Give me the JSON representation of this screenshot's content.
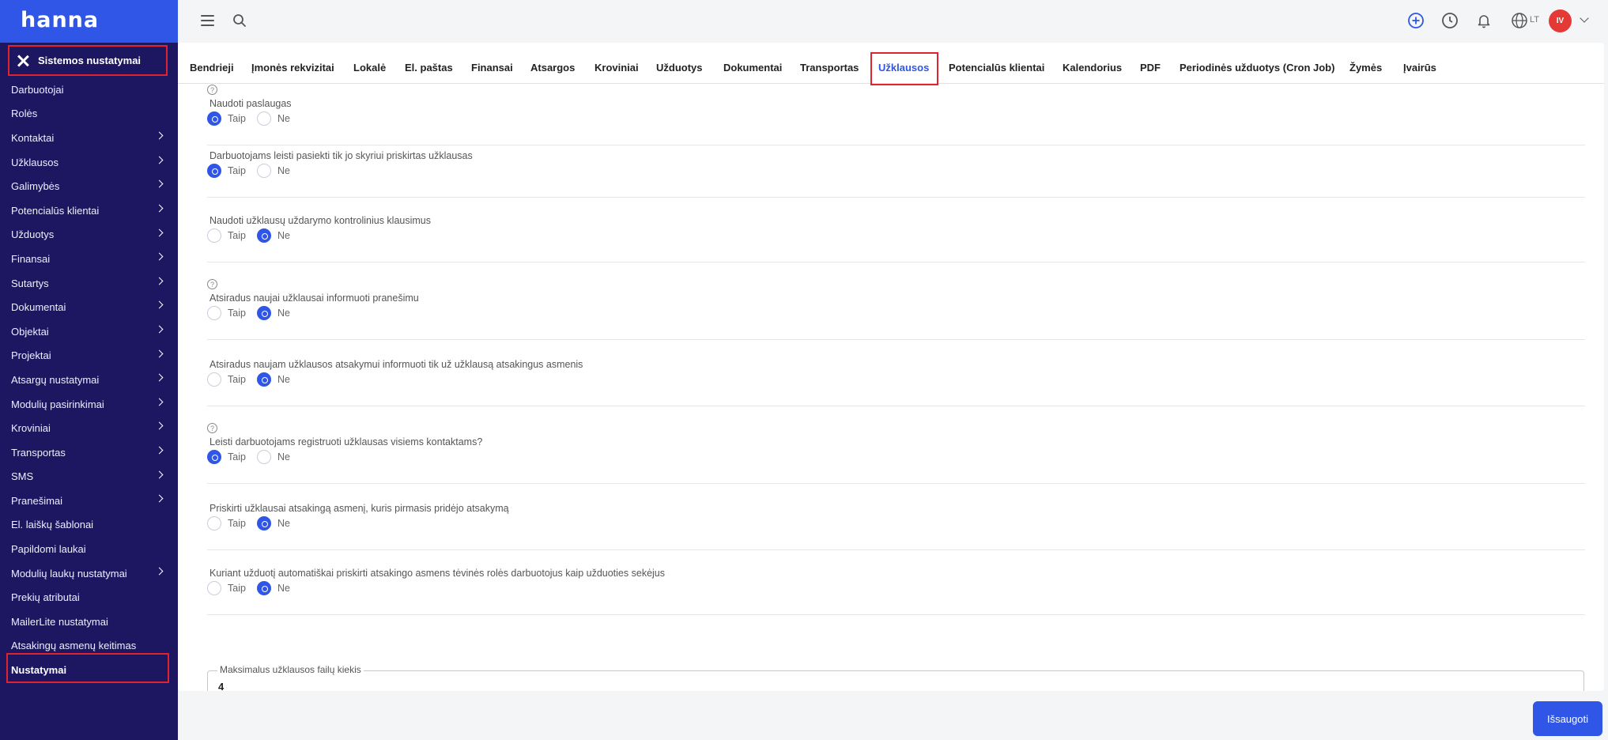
{
  "app": {
    "logo": "hanna"
  },
  "sidebar": {
    "header": "Sistemos nustatymai",
    "items": [
      {
        "label": "Darbuotojai",
        "chevron": false
      },
      {
        "label": "Rolės",
        "chevron": false
      },
      {
        "label": "Kontaktai",
        "chevron": true
      },
      {
        "label": "Užklausos",
        "chevron": true
      },
      {
        "label": "Galimybės",
        "chevron": true
      },
      {
        "label": "Potencialūs klientai",
        "chevron": true
      },
      {
        "label": "Užduotys",
        "chevron": true
      },
      {
        "label": "Finansai",
        "chevron": true
      },
      {
        "label": "Sutartys",
        "chevron": true
      },
      {
        "label": "Dokumentai",
        "chevron": true
      },
      {
        "label": "Objektai",
        "chevron": true
      },
      {
        "label": "Projektai",
        "chevron": true
      },
      {
        "label": "Atsargų nustatymai",
        "chevron": true
      },
      {
        "label": "Modulių pasirinkimai",
        "chevron": true
      },
      {
        "label": "Kroviniai",
        "chevron": true
      },
      {
        "label": "Transportas",
        "chevron": true
      },
      {
        "label": "SMS",
        "chevron": true
      },
      {
        "label": "Pranešimai",
        "chevron": true
      },
      {
        "label": "El. laiškų šablonai",
        "chevron": false
      },
      {
        "label": "Papildomi laukai",
        "chevron": false
      },
      {
        "label": "Modulių laukų nustatymai",
        "chevron": true
      },
      {
        "label": "Prekių atributai",
        "chevron": false
      },
      {
        "label": "MailerLite nustatymai",
        "chevron": false
      },
      {
        "label": "Atsakingų asmenų keitimas",
        "chevron": false
      },
      {
        "label": "Nustatymai",
        "chevron": false,
        "active": true
      }
    ]
  },
  "topbar": {
    "icons": [
      "menu-icon",
      "search-icon",
      "plus-circle-icon",
      "clock-icon",
      "bell-icon",
      "globe-icon"
    ],
    "language": "LT",
    "avatar_initials": "IV",
    "avatar_color": "#e53935"
  },
  "tabs": {
    "items": [
      "Bendrieji",
      "Įmonės rekvizitai",
      "Lokalė",
      "El. paštas",
      "Finansai",
      "Atsargos",
      "Kroviniai",
      "Užduotys",
      "Dokumentai",
      "Transportas",
      "Užklausos",
      "Potencialūs klientai",
      "Kalendorius",
      "PDF",
      "Periodinės užduotys (Cron Job)",
      "Žymės",
      "Įvairūs"
    ],
    "active": "Užklausos"
  },
  "settings": {
    "options": {
      "yes": "Taip",
      "no": "Ne"
    },
    "help_glyph": "?",
    "items": [
      {
        "label": "Naudoti paslaugas",
        "help": true,
        "value": "yes"
      },
      {
        "label": "Darbuotojams leisti pasiekti tik jo skyriui priskirtas užklausas",
        "help": false,
        "value": "yes"
      },
      {
        "label": "Naudoti užklausų uždarymo kontrolinius klausimus",
        "help": false,
        "value": "no"
      },
      {
        "label": "Atsiradus naujai užklausai informuoti pranešimu",
        "help": true,
        "value": "no"
      },
      {
        "label": "Atsiradus naujam užklausos atsakymui informuoti tik už užklausą atsakingus asmenis",
        "help": false,
        "value": "no"
      },
      {
        "label": "Leisti darbuotojams registruoti užklausas visiems kontaktams?",
        "help": true,
        "value": "yes"
      },
      {
        "label": "Priskirti užklausai atsakingą asmenį, kuris pirmasis pridėjo atsakymą",
        "help": false,
        "value": "no"
      },
      {
        "label": "Kuriant užduotį automatiškai priskirti atsakingo asmens tėvinės rolės darbuotojus kaip užduoties sekėjus",
        "help": false,
        "value": "no"
      }
    ],
    "max_files": {
      "label": "Maksimalus užklausos failų kiekis",
      "value": "4"
    }
  },
  "actions": {
    "save_label": "Išsaugoti"
  },
  "colors": {
    "accent": "#2f56e6",
    "sidebar": "#1c1760",
    "highlight": "#e0232e"
  }
}
